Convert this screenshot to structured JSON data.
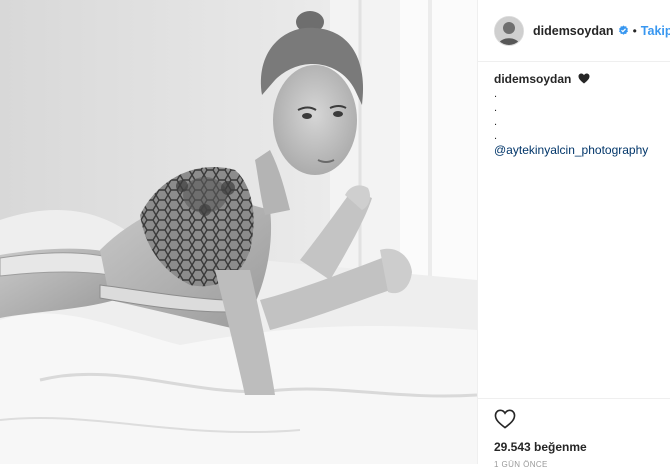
{
  "post": {
    "photo": {
      "alt": "Black and white photo",
      "tattoo_icon": "geometric-tattoo"
    },
    "header": {
      "username": "didemsoydan",
      "verified_icon": "verified-badge-icon",
      "separator": "•",
      "follow_label": "Takip Et"
    },
    "caption": {
      "username": "didemsoydan",
      "emoji": "black-heart-icon",
      "lines": [
        ".",
        ".",
        ".",
        "."
      ],
      "mention": "@aytekinyalcin_photography"
    },
    "actions": {
      "like_icon": "heart-outline-icon",
      "likes_text": "29.543 beğenme",
      "time_text": "1 GÜN ÖNCE"
    },
    "colors": {
      "link": "#3897f0",
      "mention": "#003569",
      "text": "#262626",
      "muted": "#999999",
      "border": "#efefef"
    }
  }
}
